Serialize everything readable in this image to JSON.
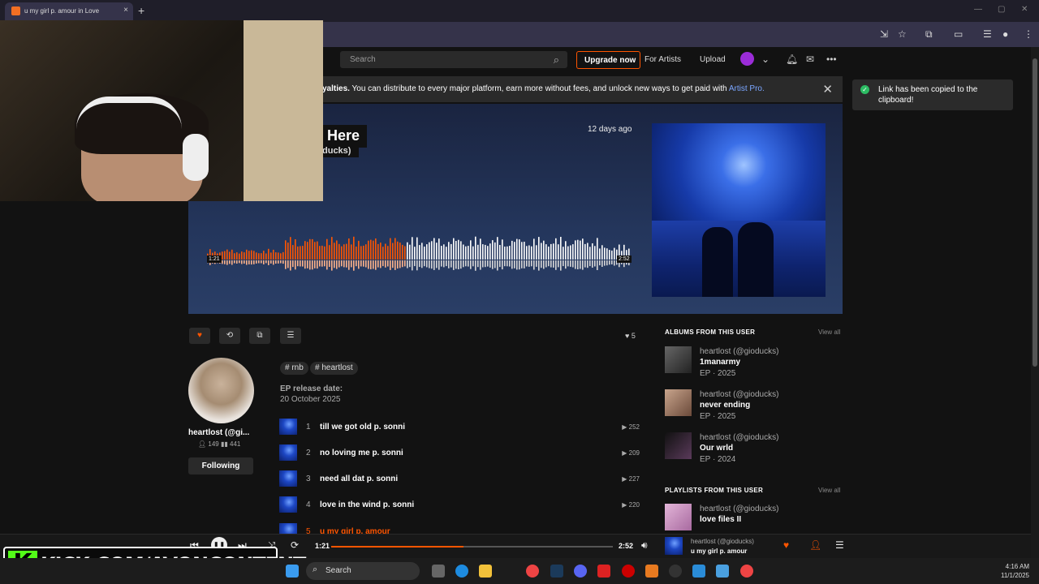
{
  "browser": {
    "tab_title": "u my girl p. amour in Love",
    "new_tab": "+",
    "close_tab": "×"
  },
  "header": {
    "search_placeholder": "Search",
    "upgrade_label": "Upgrade now",
    "for_artists_label": "For Artists",
    "upload_label": "Upload"
  },
  "banner": {
    "bold_text": "yalties.",
    "text": " You can distribute to every major platform, earn more without fees, and unlock new ways to get paid with ",
    "link_text": "Artist Pro."
  },
  "toast": {
    "message": "Link has been copied to the clipboard!"
  },
  "hero": {
    "title_fragment": "Here",
    "artist_fragment": "ducks)",
    "posted": "12 days ago",
    "elapsed": "1:21",
    "duration": "2:52",
    "played_fraction": 0.47
  },
  "actions": {
    "likes_count": "5"
  },
  "artist": {
    "name": "heartlost (@gi...",
    "followers": "149",
    "tracks": "441",
    "following_label": "Following"
  },
  "tags": [
    "rnb",
    "heartlost"
  ],
  "release": {
    "label": "EP release date:",
    "date": "20 October 2025"
  },
  "tracks": [
    {
      "num": "1",
      "title": "till we got old p. sonni",
      "plays": "252"
    },
    {
      "num": "2",
      "title": "no loving me p. sonni",
      "plays": "209"
    },
    {
      "num": "3",
      "title": "need all dat p. sonni",
      "plays": "227"
    },
    {
      "num": "4",
      "title": "love in the wind p. sonni",
      "plays": "220"
    },
    {
      "num": "5",
      "title": "u my girl p. amour",
      "plays": ""
    }
  ],
  "albums": {
    "title": "ALBUMS FROM THIS USER",
    "view_all": "View all",
    "items": [
      {
        "user": "heartlost (@gioducks)",
        "name": "1manarmy",
        "meta": "EP · 2025"
      },
      {
        "user": "heartlost (@gioducks)",
        "name": "never ending",
        "meta": "EP · 2025"
      },
      {
        "user": "heartlost (@gioducks)",
        "name": "Our wrld",
        "meta": "EP · 2024"
      }
    ]
  },
  "playlists": {
    "title": "PLAYLISTS FROM THIS USER",
    "view_all": "View all",
    "items": [
      {
        "user": "heartlost (@gioducks)",
        "name": "love files II"
      }
    ]
  },
  "player": {
    "elapsed": "1:21",
    "duration": "2:52",
    "progress": 0.47,
    "user": "heartlost (@gioducks)",
    "title": "u my girl p. amour"
  },
  "overlay": {
    "kick_text": "KICK.COM/AVONCONTENT"
  },
  "taskbar": {
    "search_label": "Search",
    "time": "4:16 AM",
    "date": "11/1/2025"
  },
  "colors": {
    "accent": "#ff5500",
    "kick_green": "#53fc18",
    "link": "#7ba6ff"
  }
}
